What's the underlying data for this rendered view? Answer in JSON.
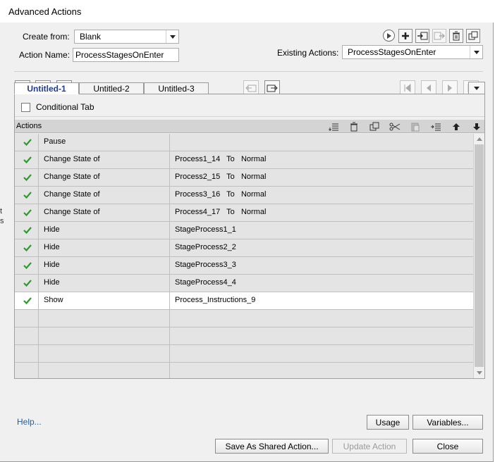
{
  "window": {
    "title": "Advanced Actions"
  },
  "edge_fragments": [
    "t",
    "s"
  ],
  "form": {
    "create_from_label": "Create from:",
    "create_from_value": "Blank",
    "action_name_label": "Action Name:",
    "action_name_value": "ProcessStagesOnEnter",
    "existing_actions_label": "Existing Actions:",
    "existing_actions_value": "ProcessStagesOnEnter"
  },
  "tabs": [
    {
      "label": "Untitled-1",
      "active": true
    },
    {
      "label": "Untitled-2",
      "active": false
    },
    {
      "label": "Untitled-3",
      "active": false
    }
  ],
  "conditional_tab_label": "Conditional Tab",
  "actions_header": "Actions",
  "rows": [
    {
      "action": "Pause",
      "target": "",
      "selected": false,
      "enabled": true
    },
    {
      "action": "Change State of",
      "target": "Process1_14   To   Normal",
      "selected": false,
      "enabled": true
    },
    {
      "action": "Change State of",
      "target": "Process2_15   To   Normal",
      "selected": false,
      "enabled": true
    },
    {
      "action": "Change State of",
      "target": "Process3_16   To   Normal",
      "selected": false,
      "enabled": true
    },
    {
      "action": "Change State of",
      "target": "Process4_17   To   Normal",
      "selected": false,
      "enabled": true
    },
    {
      "action": "Hide",
      "target": "StageProcess1_1",
      "selected": false,
      "enabled": true
    },
    {
      "action": "Hide",
      "target": "StageProcess2_2",
      "selected": false,
      "enabled": true
    },
    {
      "action": "Hide",
      "target": "StageProcess3_3",
      "selected": false,
      "enabled": true
    },
    {
      "action": "Hide",
      "target": "StageProcess4_4",
      "selected": false,
      "enabled": true
    },
    {
      "action": "Show",
      "target": "Process_Instructions_9",
      "selected": true,
      "enabled": true
    },
    {
      "action": "",
      "target": "",
      "selected": false,
      "enabled": false
    },
    {
      "action": "",
      "target": "",
      "selected": false,
      "enabled": false
    },
    {
      "action": "",
      "target": "",
      "selected": false,
      "enabled": false
    },
    {
      "action": "",
      "target": "",
      "selected": false,
      "enabled": false
    }
  ],
  "buttons": {
    "usage": "Usage",
    "variables": "Variables...",
    "save_shared": "Save As Shared Action...",
    "update": "Update Action",
    "close": "Close",
    "help": "Help..."
  },
  "colors": {
    "check": "#2e9a2e",
    "link": "#1f5fa8",
    "active_tab": "#1f3a93"
  }
}
